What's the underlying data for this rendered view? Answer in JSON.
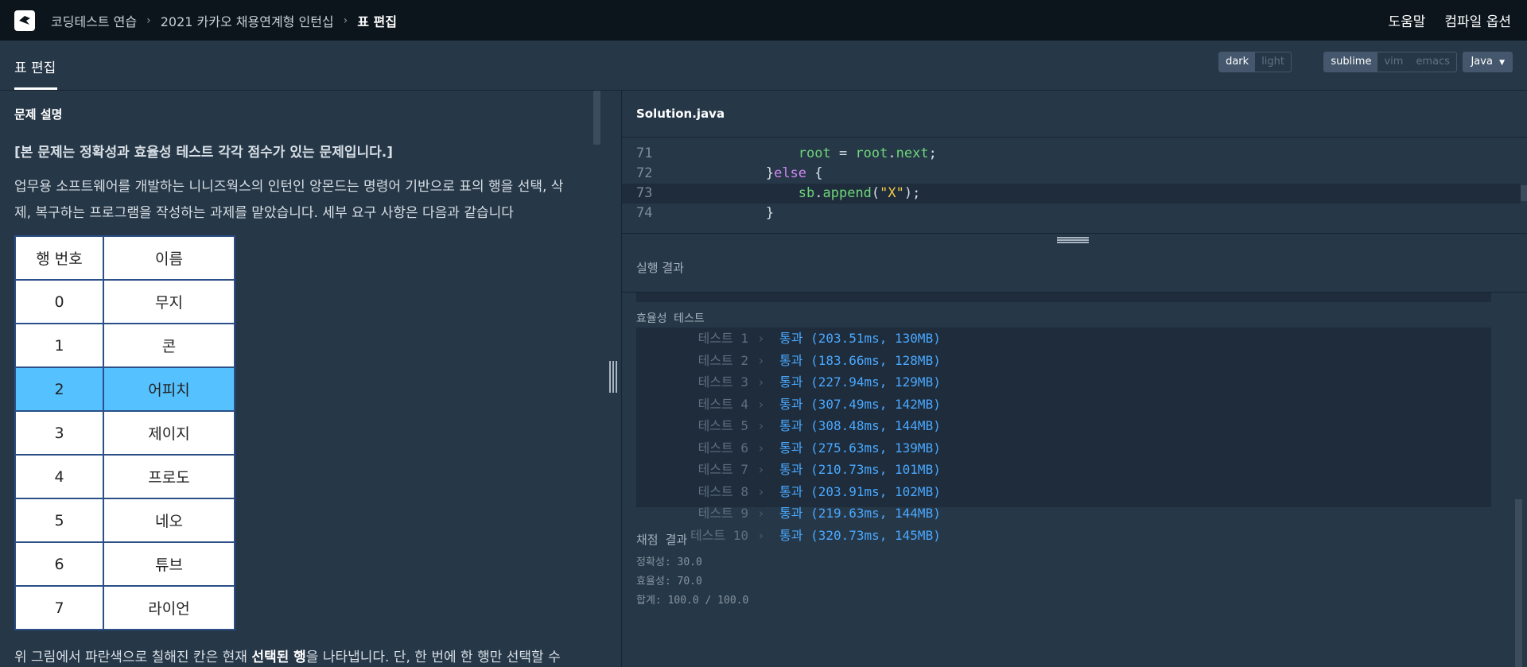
{
  "header": {
    "breadcrumb": [
      "코딩테스트 연습",
      "2021 카카오 채용연계형 인턴십",
      "표 편집"
    ],
    "help": "도움말",
    "compile_options": "컴파일 옵션"
  },
  "toolbar": {
    "tab_title": "표 편집",
    "theme": {
      "options": [
        "dark",
        "light"
      ],
      "selected": "dark"
    },
    "keymap": {
      "options": [
        "sublime",
        "vim",
        "emacs"
      ],
      "selected": "sublime"
    },
    "language": "Java"
  },
  "problem": {
    "section_title": "문제 설명",
    "lead": "[본 문제는 정확성과 효율성 테스트 각각 점수가 있는 문제입니다.]",
    "para": "업무용 소프트웨어를 개발하는 니니즈웍스의 인턴인 앙몬드는 명령어 기반으로 표의 행을 선택, 삭제, 복구하는 프로그램을 작성하는 과제를 맡았습니다. 세부 요구 사항은 다음과 같습니다",
    "table": {
      "headers": [
        "행 번호",
        "이름"
      ],
      "rows": [
        [
          "0",
          "무지"
        ],
        [
          "1",
          "콘"
        ],
        [
          "2",
          "어피치"
        ],
        [
          "3",
          "제이지"
        ],
        [
          "4",
          "프로도"
        ],
        [
          "5",
          "네오"
        ],
        [
          "6",
          "튜브"
        ],
        [
          "7",
          "라이언"
        ]
      ],
      "selected_row": 2
    },
    "bottom_pre": "위 그림에서 파란색으로 칠해진 칸은 현재 ",
    "bottom_bold": "선택된 행",
    "bottom_post": "을 나타냅니다. 단, 한 번에 한 행만 선택할 수"
  },
  "editor": {
    "filename": "Solution.java",
    "lines": [
      {
        "num": "71",
        "indent": "                ",
        "tokens": [
          [
            "root",
            "#6fd67a"
          ],
          [
            " = ",
            "#d8dfe6"
          ],
          [
            "root",
            "#6fd67a"
          ],
          [
            ".",
            "#d8dfe6"
          ],
          [
            "next",
            "#6fd67a"
          ],
          [
            ";",
            "#d8dfe6"
          ]
        ]
      },
      {
        "num": "72",
        "indent": "            ",
        "tokens": [
          [
            "}",
            "#d8dfe6"
          ],
          [
            "else",
            "#d086f0"
          ],
          [
            " {",
            "#d8dfe6"
          ]
        ]
      },
      {
        "num": "73",
        "indent": "                ",
        "tokens": [
          [
            "sb",
            "#6fd67a"
          ],
          [
            ".",
            "#d8dfe6"
          ],
          [
            "append",
            "#6fd67a"
          ],
          [
            "(",
            "#d8dfe6"
          ],
          [
            "\"X\"",
            "#f2c94c"
          ],
          [
            ");",
            "#d8dfe6"
          ]
        ]
      },
      {
        "num": "74",
        "indent": "            ",
        "tokens": [
          [
            "}",
            "#d8dfe6"
          ]
        ]
      }
    ],
    "highlighted_line": "73"
  },
  "results": {
    "title": "실행 결과",
    "efficiency_label": "효율성  테스트",
    "tests": [
      {
        "name": "테스트 1",
        "result": "통과 (203.51ms, 130MB)"
      },
      {
        "name": "테스트 2",
        "result": "통과 (183.66ms, 128MB)"
      },
      {
        "name": "테스트 3",
        "result": "통과 (227.94ms, 129MB)"
      },
      {
        "name": "테스트 4",
        "result": "통과 (307.49ms, 142MB)"
      },
      {
        "name": "테스트 5",
        "result": "통과 (308.48ms, 144MB)"
      },
      {
        "name": "테스트 6",
        "result": "통과 (275.63ms, 139MB)"
      },
      {
        "name": "테스트 7",
        "result": "통과 (210.73ms, 101MB)"
      },
      {
        "name": "테스트 8",
        "result": "통과 (203.91ms, 102MB)"
      },
      {
        "name": "테스트 9",
        "result": "통과 (219.63ms, 144MB)"
      },
      {
        "name": "테스트 10",
        "result": "통과 (320.73ms, 145MB)"
      }
    ],
    "score_title": "채점 결과",
    "accuracy": "정확성: 30.0",
    "efficiency": "효율성: 70.0",
    "total": "합계: 100.0 / 100.0"
  }
}
